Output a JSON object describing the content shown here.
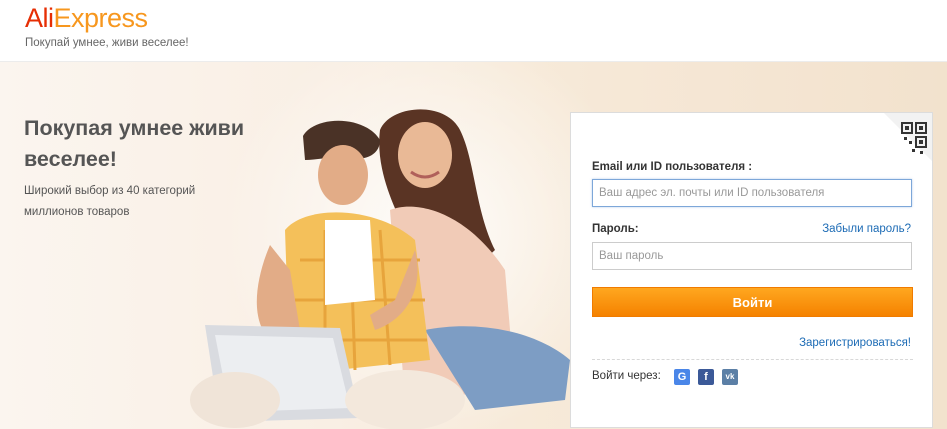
{
  "header": {
    "logo_part1": "Ali",
    "logo_part2": "Express",
    "tagline": "Покупай умнее, живи веселее!"
  },
  "promo": {
    "title": "Покупая умнее живи веселее!",
    "subtitle": "Широкий выбор из 40 категорий миллионов товаров"
  },
  "login": {
    "email_label": "Email или ID пользователя :",
    "email_placeholder": "Ваш адрес эл. почты или ID пользователя",
    "password_label": "Пароль:",
    "forgot_password": "Забыли пароль?",
    "password_placeholder": "Ваш пароль",
    "submit": "Войти",
    "register": "Зарегистрироваться!",
    "social_label": "Войти через:",
    "social": [
      {
        "icon": "google-icon",
        "glyph": "G"
      },
      {
        "icon": "facebook-icon",
        "glyph": "f"
      },
      {
        "icon": "vk-icon",
        "glyph": "vk"
      }
    ],
    "qr_icon": "qr-code-icon"
  },
  "colors": {
    "logo_red": "#e62e04",
    "logo_orange": "#f7971e",
    "button": "#f58200",
    "link": "#1c6bb5"
  }
}
